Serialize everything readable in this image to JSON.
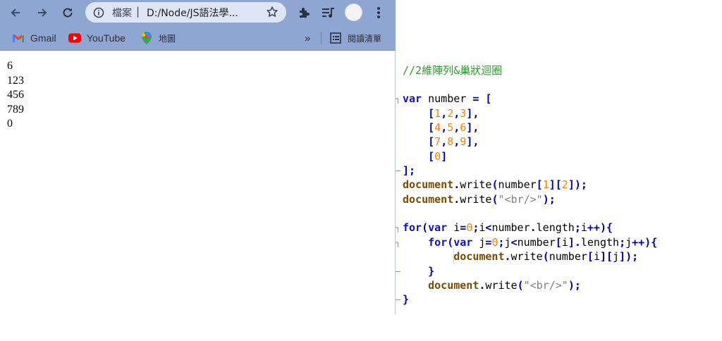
{
  "browser": {
    "nav": {
      "back": "back",
      "forward": "forward",
      "reload": "reload"
    },
    "omnibox": {
      "scheme_label": "檔案",
      "separator": "|",
      "url": "D:/Node/JS語法學..."
    },
    "bookmarks": [
      {
        "label": "Gmail",
        "icon": "gmail-icon"
      },
      {
        "label": "YouTube",
        "icon": "youtube-icon"
      },
      {
        "label": "地圖",
        "icon": "maps-icon"
      }
    ],
    "overflow_label": "»",
    "reading_list_label": "閱讀清單",
    "page_output": [
      "6",
      "123",
      "456",
      "789",
      "0"
    ],
    "colors": {
      "toolbar": "#8fa6d3",
      "omnibox": "#dfe6f3"
    }
  },
  "editor": {
    "lines": [
      [
        [
          "com",
          "//2維陣列&巢狀迴圈"
        ]
      ],
      [],
      [
        [
          "kw",
          "var"
        ],
        [
          "id",
          " number "
        ],
        [
          "op",
          "="
        ],
        [
          "id",
          " "
        ],
        [
          "op",
          "["
        ]
      ],
      [
        [
          "id",
          "    "
        ],
        [
          "op",
          "["
        ],
        [
          "num",
          "1"
        ],
        [
          "op",
          ","
        ],
        [
          "num",
          "2"
        ],
        [
          "op",
          ","
        ],
        [
          "num",
          "3"
        ],
        [
          "op",
          "],"
        ]
      ],
      [
        [
          "id",
          "    "
        ],
        [
          "op",
          "["
        ],
        [
          "num",
          "4"
        ],
        [
          "op",
          ","
        ],
        [
          "num",
          "5"
        ],
        [
          "op",
          ","
        ],
        [
          "num",
          "6"
        ],
        [
          "op",
          "],"
        ]
      ],
      [
        [
          "id",
          "    "
        ],
        [
          "op",
          "["
        ],
        [
          "num",
          "7"
        ],
        [
          "op",
          ","
        ],
        [
          "num",
          "8"
        ],
        [
          "op",
          ","
        ],
        [
          "num",
          "9"
        ],
        [
          "op",
          "],"
        ]
      ],
      [
        [
          "id",
          "    "
        ],
        [
          "op",
          "["
        ],
        [
          "num",
          "0"
        ],
        [
          "op",
          "]"
        ]
      ],
      [
        [
          "op",
          "];"
        ]
      ],
      [
        [
          "obj",
          "document"
        ],
        [
          "op",
          "."
        ],
        [
          "meth",
          "write"
        ],
        [
          "op",
          "("
        ],
        [
          "id",
          "number"
        ],
        [
          "op",
          "["
        ],
        [
          "num",
          "1"
        ],
        [
          "op",
          "]["
        ],
        [
          "num",
          "2"
        ],
        [
          "op",
          "]);"
        ]
      ],
      [
        [
          "obj",
          "document"
        ],
        [
          "op",
          "."
        ],
        [
          "meth",
          "write"
        ],
        [
          "op",
          "("
        ],
        [
          "str",
          "\"<br/>\""
        ],
        [
          "op",
          ");"
        ]
      ],
      [],
      [
        [
          "kw",
          "for"
        ],
        [
          "op",
          "("
        ],
        [
          "kw",
          "var"
        ],
        [
          "id",
          " i"
        ],
        [
          "op",
          "="
        ],
        [
          "num",
          "0"
        ],
        [
          "op",
          ";"
        ],
        [
          "id",
          "i"
        ],
        [
          "op",
          "<"
        ],
        [
          "id",
          "number"
        ],
        [
          "op",
          "."
        ],
        [
          "id",
          "length"
        ],
        [
          "op",
          ";"
        ],
        [
          "id",
          "i"
        ],
        [
          "op",
          "++){"
        ]
      ],
      [
        [
          "id",
          "    "
        ],
        [
          "kw",
          "for"
        ],
        [
          "op",
          "("
        ],
        [
          "kw",
          "var"
        ],
        [
          "id",
          " j"
        ],
        [
          "op",
          "="
        ],
        [
          "num",
          "0"
        ],
        [
          "op",
          ";"
        ],
        [
          "id",
          "j"
        ],
        [
          "op",
          "<"
        ],
        [
          "id",
          "number"
        ],
        [
          "op",
          "["
        ],
        [
          "id",
          "i"
        ],
        [
          "op",
          "]."
        ],
        [
          "id",
          "length"
        ],
        [
          "op",
          ";"
        ],
        [
          "id",
          "j"
        ],
        [
          "op",
          "++){"
        ]
      ],
      [
        [
          "id",
          "        "
        ],
        [
          "obj",
          "document"
        ],
        [
          "op",
          "."
        ],
        [
          "meth",
          "write"
        ],
        [
          "op",
          "("
        ],
        [
          "id",
          "number"
        ],
        [
          "op",
          "["
        ],
        [
          "id",
          "i"
        ],
        [
          "op",
          "]["
        ],
        [
          "id",
          "j"
        ],
        [
          "op",
          "]);"
        ]
      ],
      [
        [
          "id",
          "    "
        ],
        [
          "op",
          "}"
        ]
      ],
      [
        [
          "id",
          "    "
        ],
        [
          "obj",
          "document"
        ],
        [
          "op",
          "."
        ],
        [
          "meth",
          "write"
        ],
        [
          "op",
          "("
        ],
        [
          "str",
          "\"<br/>\""
        ],
        [
          "op",
          ");"
        ]
      ],
      [
        [
          "op",
          "}"
        ]
      ]
    ],
    "colors": {
      "comment": "#2e9a2e",
      "keyword": "#1010c8",
      "number": "#ff8000",
      "string": "#808080",
      "object": "#7a4a00"
    }
  }
}
